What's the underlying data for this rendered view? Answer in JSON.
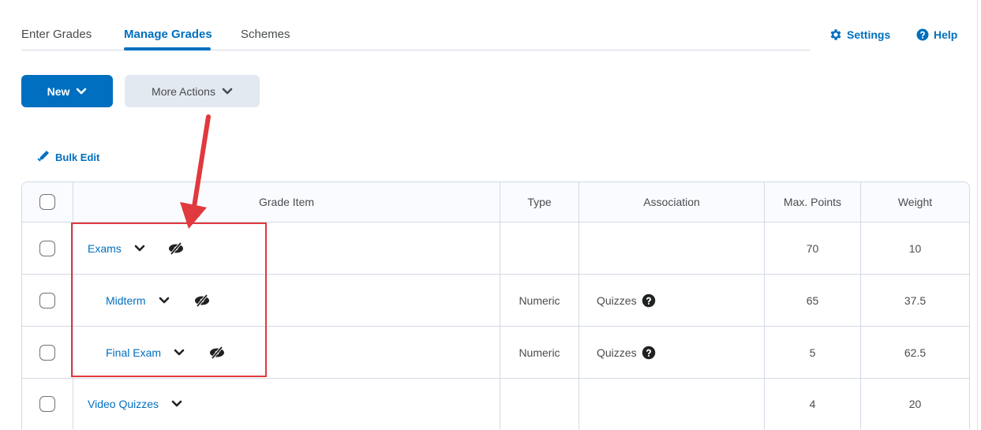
{
  "tabs": [
    {
      "label": "Enter Grades",
      "active": false
    },
    {
      "label": "Manage Grades",
      "active": true
    },
    {
      "label": "Schemes",
      "active": false
    }
  ],
  "top_links": {
    "settings": "Settings",
    "help": "Help"
  },
  "toolbar": {
    "new_label": "New",
    "more_actions_label": "More Actions",
    "bulk_edit_label": "Bulk Edit"
  },
  "table": {
    "headers": {
      "grade_item": "Grade Item",
      "type": "Type",
      "association": "Association",
      "max_points": "Max. Points",
      "weight": "Weight"
    },
    "rows": [
      {
        "name": "Exams",
        "type": "",
        "association": "",
        "max_points": "70",
        "weight": "10"
      },
      {
        "name": "Midterm",
        "type": "Numeric",
        "association": "Quizzes",
        "max_points": "65",
        "weight": "37.5"
      },
      {
        "name": "Final Exam",
        "type": "Numeric",
        "association": "Quizzes",
        "max_points": "5",
        "weight": "62.5"
      },
      {
        "name": "Video Quizzes",
        "type": "",
        "association": "",
        "max_points": "4",
        "weight": "20"
      }
    ]
  },
  "colors": {
    "accent": "#006fbf",
    "annotation": "#e0393e"
  }
}
